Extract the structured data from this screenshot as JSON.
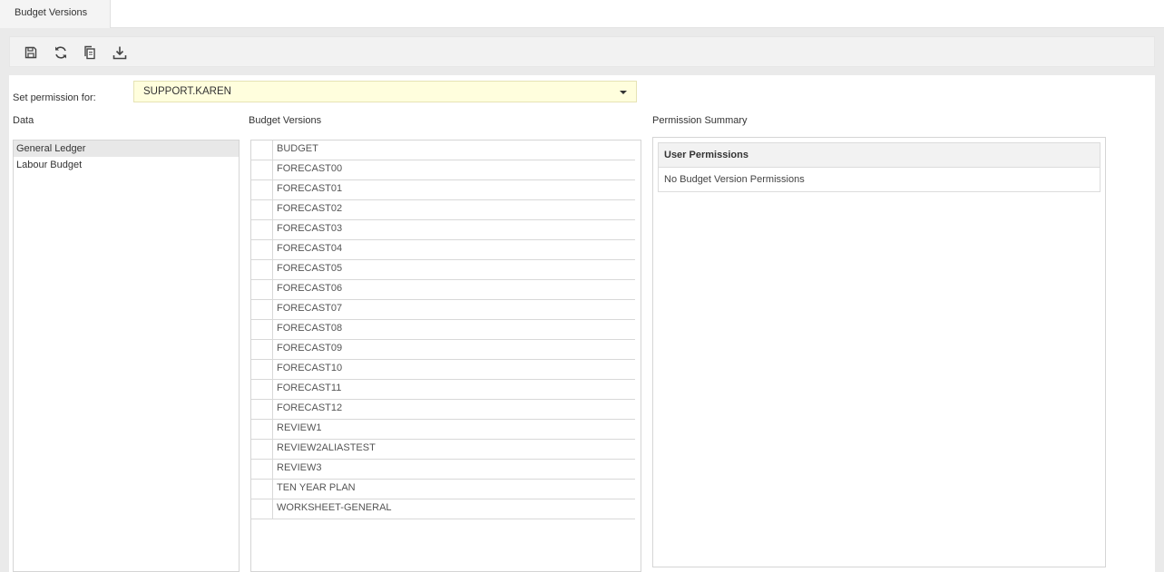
{
  "tab": {
    "label": "Budget Versions"
  },
  "toolbar": {
    "icons": [
      "save-icon",
      "refresh-icon",
      "copy-icon",
      "download-icon"
    ]
  },
  "permission": {
    "label": "Set permission for:",
    "selected_user": "SUPPORT.KAREN"
  },
  "data_panel": {
    "title": "Data",
    "items": [
      "General Ledger",
      "Labour Budget"
    ],
    "selected": "General Ledger"
  },
  "budget_versions": {
    "title": "Budget Versions",
    "items": [
      "BUDGET",
      "FORECAST00",
      "FORECAST01",
      "FORECAST02",
      "FORECAST03",
      "FORECAST04",
      "FORECAST05",
      "FORECAST06",
      "FORECAST07",
      "FORECAST08",
      "FORECAST09",
      "FORECAST10",
      "FORECAST11",
      "FORECAST12",
      "REVIEW1",
      "REVIEW2ALIASTEST",
      "REVIEW3",
      "TEN YEAR PLAN",
      "WORKSHEET-GENERAL"
    ]
  },
  "permission_summary": {
    "title": "Permission Summary",
    "header": "User Permissions",
    "empty_text": "No Budget Version Permissions"
  }
}
